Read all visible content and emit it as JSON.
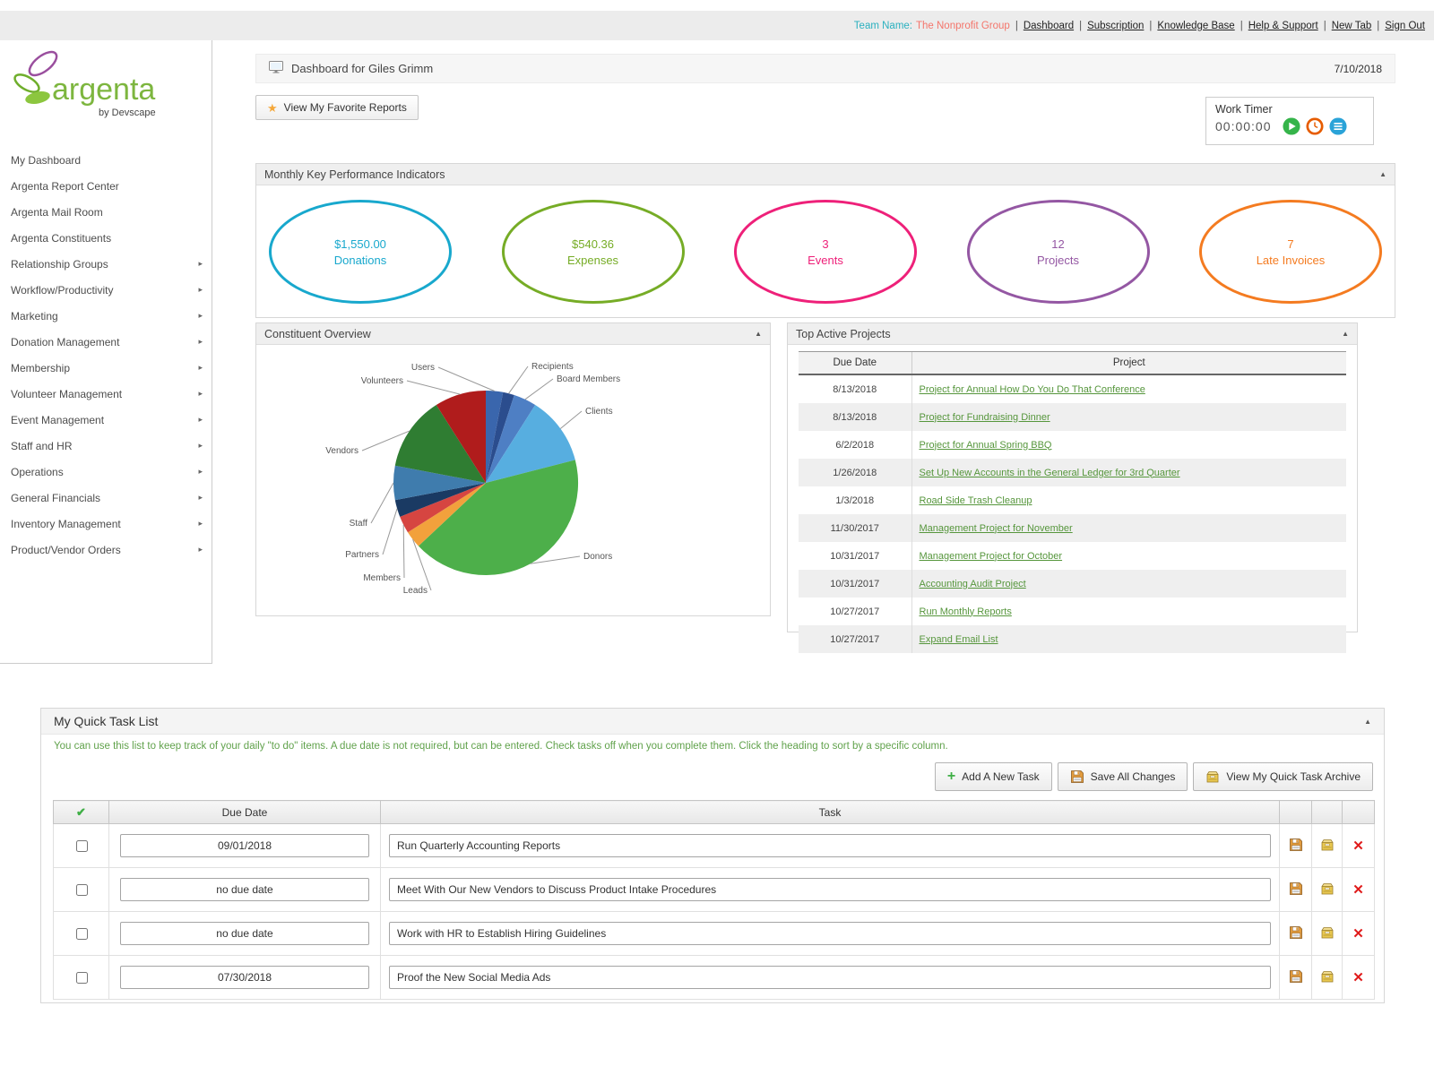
{
  "topbar": {
    "team_label": "Team Name:",
    "team_name": "The Nonprofit Group",
    "links": [
      "Dashboard",
      "Subscription",
      "Knowledge Base",
      "Help & Support",
      "New Tab",
      "Sign Out"
    ]
  },
  "logo": {
    "brand": "argenta",
    "byline": "by Devscape"
  },
  "sidebar": {
    "items": [
      {
        "label": "My Dashboard",
        "expandable": false
      },
      {
        "label": "Argenta Report Center",
        "expandable": false
      },
      {
        "label": "Argenta Mail Room",
        "expandable": false
      },
      {
        "label": "Argenta Constituents",
        "expandable": false
      },
      {
        "label": "Relationship Groups",
        "expandable": true
      },
      {
        "label": "Workflow/Productivity",
        "expandable": true
      },
      {
        "label": "Marketing",
        "expandable": true
      },
      {
        "label": "Donation Management",
        "expandable": true
      },
      {
        "label": "Membership",
        "expandable": true
      },
      {
        "label": "Volunteer Management",
        "expandable": true
      },
      {
        "label": "Event Management",
        "expandable": true
      },
      {
        "label": "Staff and HR",
        "expandable": true
      },
      {
        "label": "Operations",
        "expandable": true
      },
      {
        "label": "General Financials",
        "expandable": true
      },
      {
        "label": "Inventory Management",
        "expandable": true
      },
      {
        "label": "Product/Vendor Orders",
        "expandable": true
      }
    ]
  },
  "header": {
    "title": "Dashboard for Giles Grimm",
    "date": "7/10/2018",
    "favorites_button": "View My Favorite Reports"
  },
  "work_timer": {
    "title": "Work Timer",
    "time": "00:00:00"
  },
  "kpi": {
    "title": "Monthly Key Performance Indicators",
    "items": [
      {
        "value": "$1,550.00",
        "label": "Donations",
        "color": "#18a8cd"
      },
      {
        "value": "$540.36",
        "label": "Expenses",
        "color": "#76ac26"
      },
      {
        "value": "3",
        "label": "Events",
        "color": "#ee2079"
      },
      {
        "value": "12",
        "label": "Projects",
        "color": "#9457a3"
      },
      {
        "value": "7",
        "label": "Late Invoices",
        "color": "#f47b20"
      }
    ]
  },
  "chart_data": {
    "type": "pie",
    "title": "Constituent Overview",
    "labels": [
      "Users",
      "Recipients",
      "Board Members",
      "Clients",
      "Donors",
      "Leads",
      "Members",
      "Partners",
      "Staff",
      "Vendors",
      "Volunteers"
    ],
    "values": [
      3,
      2,
      4,
      12,
      42,
      3,
      3,
      3,
      6,
      13,
      9
    ],
    "unit": "percent (estimated from slice angles)",
    "colors": [
      "#3a66ad",
      "#2b4d8e",
      "#4e7fc4",
      "#57aee0",
      "#4daf4a",
      "#f2a13c",
      "#d64541",
      "#1a3a63",
      "#3f7cad",
      "#2f7d32",
      "#b01c1c"
    ],
    "legend_position": "none",
    "label_positions": {
      "Users": [
        -53,
        -129,
        "end"
      ],
      "Recipients": [
        47,
        -130,
        "start"
      ],
      "Board Members": [
        75,
        -116,
        "start"
      ],
      "Clients": [
        107,
        -80,
        "start"
      ],
      "Donors": [
        105,
        82,
        "start"
      ],
      "Leads": [
        -61,
        120,
        "end"
      ],
      "Members": [
        -91,
        106,
        "end"
      ],
      "Partners": [
        -115,
        80,
        "end"
      ],
      "Staff": [
        -128,
        45,
        "end"
      ],
      "Vendors": [
        -138,
        -36,
        "end"
      ],
      "Volunteers": [
        -88,
        -114,
        "end"
      ]
    }
  },
  "projects": {
    "title": "Top Active Projects",
    "columns": [
      "Due Date",
      "Project"
    ],
    "rows": [
      {
        "due_date": "8/13/2018",
        "project": "Project for Annual How Do You Do That Conference"
      },
      {
        "due_date": "8/13/2018",
        "project": "Project for Fundraising Dinner"
      },
      {
        "due_date": "6/2/2018",
        "project": "Project for Annual Spring BBQ"
      },
      {
        "due_date": "1/26/2018",
        "project": "Set Up New Accounts in the General Ledger for 3rd Quarter"
      },
      {
        "due_date": "1/3/2018",
        "project": "Road Side Trash Cleanup"
      },
      {
        "due_date": "11/30/2017",
        "project": "Management Project for November"
      },
      {
        "due_date": "10/31/2017",
        "project": "Management Project for October"
      },
      {
        "due_date": "10/31/2017",
        "project": "Accounting Audit Project"
      },
      {
        "due_date": "10/27/2017",
        "project": "Run Monthly Reports"
      },
      {
        "due_date": "10/27/2017",
        "project": "Expand Email List"
      }
    ]
  },
  "task_list": {
    "title": "My Quick Task List",
    "help": "You can use this list to keep track of your daily \"to do\" items. A due date is not required, but can be entered. Check tasks off when you complete them. Click the heading to sort by a specific column.",
    "buttons": {
      "add": "Add A New Task",
      "save": "Save All Changes",
      "archive": "View My Quick Task Archive"
    },
    "columns": {
      "due_date": "Due Date",
      "task": "Task"
    },
    "rows": [
      {
        "checked": false,
        "due_date": "09/01/2018",
        "task": "Run Quarterly Accounting Reports"
      },
      {
        "checked": false,
        "due_date": "no due date",
        "task": "Meet With Our New Vendors to Discuss Product Intake Procedures"
      },
      {
        "checked": false,
        "due_date": "no due date",
        "task": "Work with HR to Establish Hiring Guidelines"
      },
      {
        "checked": false,
        "due_date": "07/30/2018",
        "task": "Proof the New Social Media Ads"
      }
    ]
  },
  "icons": {
    "star": "★",
    "plus": "+",
    "check": "✔",
    "delete": "✕",
    "collapse": "▲",
    "expand": "▸",
    "separator": "|"
  }
}
